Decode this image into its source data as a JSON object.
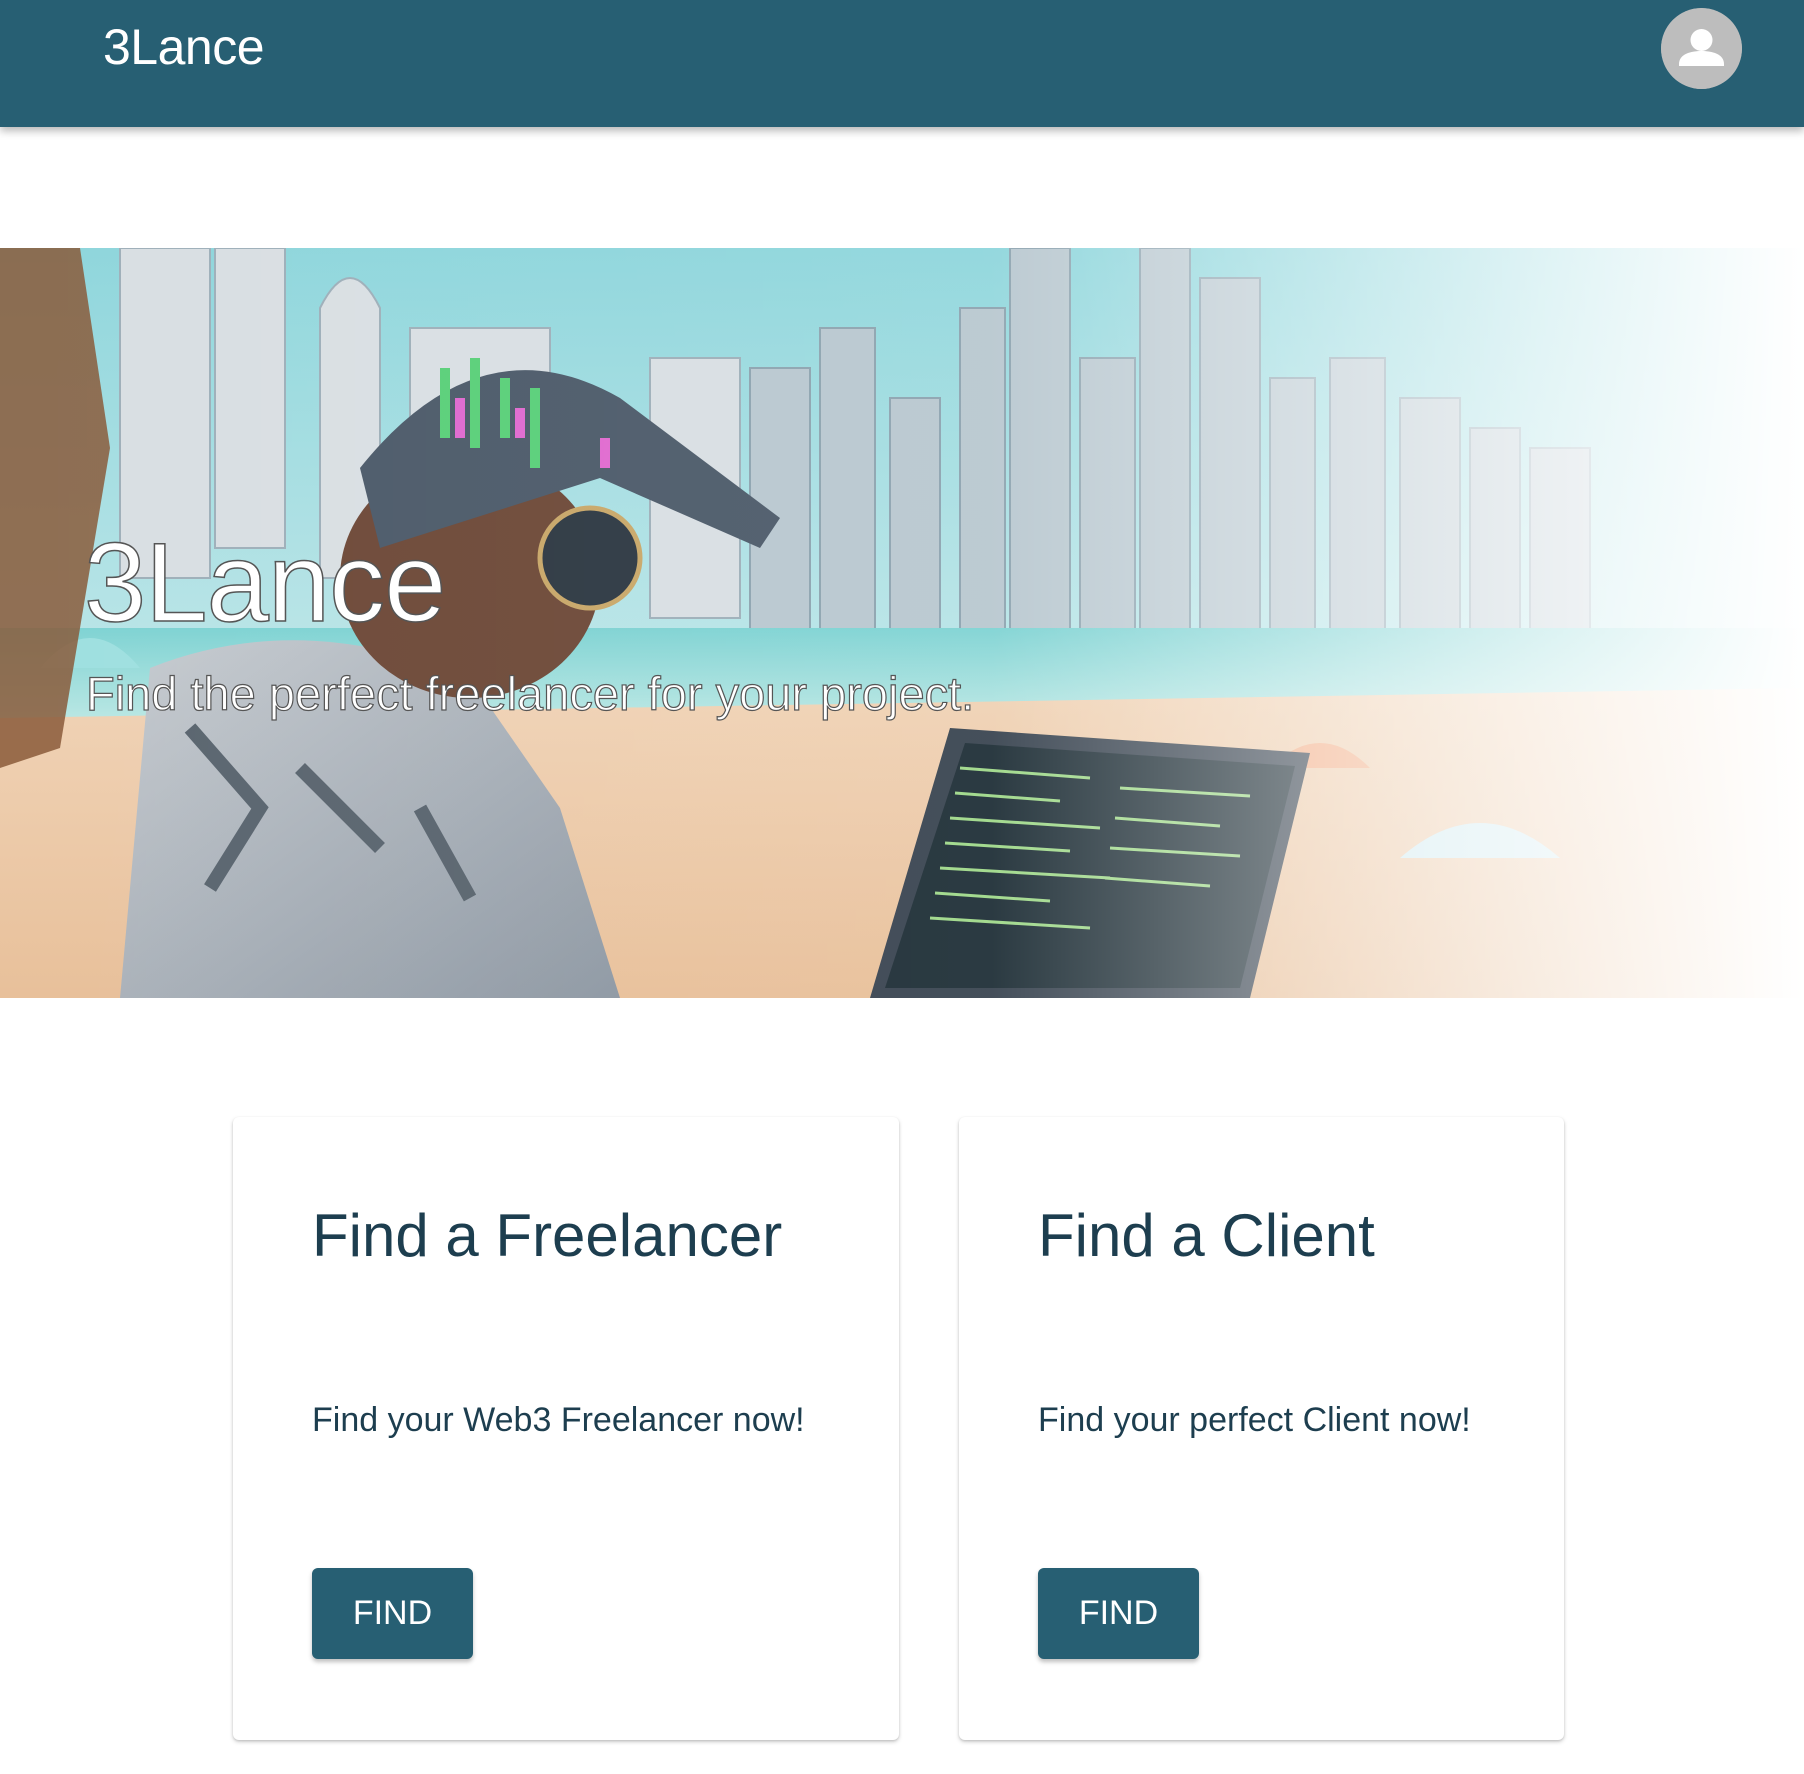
{
  "appbar": {
    "brand": "3Lance",
    "background_color": "#275f73",
    "avatar_icon": "account-circle-icon"
  },
  "hero": {
    "title": "3Lance",
    "subtitle": "Find the perfect freelancer for your project.",
    "image_description": "illustration of a freelancer with cap and headphones coding on a laptop on a city beach"
  },
  "cards": [
    {
      "title": "Find a Freelancer",
      "text": "Find your Web3 Freelancer now!",
      "button_label": "FIND"
    },
    {
      "title": "Find a Client",
      "text": "Find your perfect Client now!",
      "button_label": "FIND"
    }
  ],
  "colors": {
    "primary": "#275f73",
    "heading_text": "#1d3e4f"
  }
}
